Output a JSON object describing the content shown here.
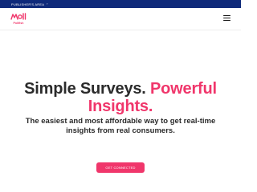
{
  "topbar": {
    "link_label": "PUBLISHER'S AREA",
    "chevron_icon": "chevron-right-icon",
    "background": "#0f2a7a"
  },
  "header": {
    "logo_icon": "brand-logo-icon",
    "logo_subtext": "Pollfish",
    "menu_icon": "hamburger-menu-icon"
  },
  "hero": {
    "title_part1": "Simple Surveys. ",
    "title_part2": "Powerful Insights.",
    "subtitle": "The easiest and most affordable way to get real-time insights from real consumers.",
    "cta_label": "GET CONNECTED",
    "accent_color": "#f0366b",
    "text_color": "#2b2b2b"
  }
}
